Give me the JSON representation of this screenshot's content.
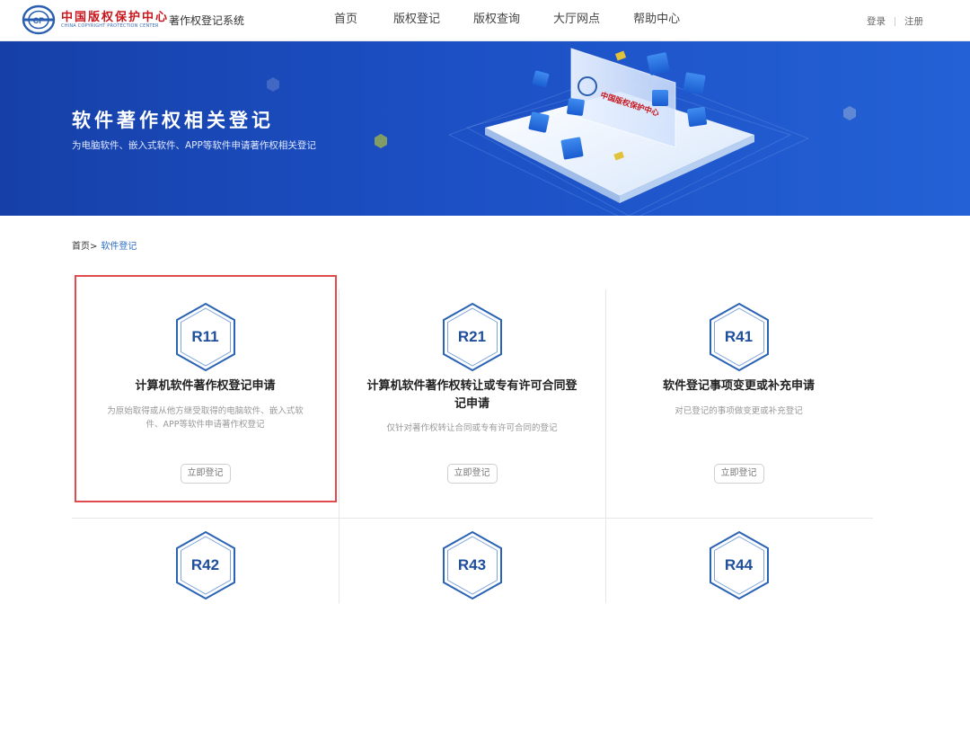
{
  "header": {
    "brand_cn": "中国版权保护中心",
    "brand_en": "CHINA COPYRIGHT PROTECTION CENTER",
    "system_title": "著作权登记系统",
    "nav": [
      "首页",
      "版权登记",
      "版权查询",
      "大厅网点",
      "帮助中心"
    ],
    "login": "登录",
    "register": "注册"
  },
  "banner": {
    "title": "软件著作权相关登记",
    "subtitle": "为电脑软件、嵌入式软件、APP等软件申请著作权相关登记",
    "board_text": "中国版权保护中心"
  },
  "breadcrumb": {
    "home": "首页>",
    "current": "软件登记"
  },
  "cards": [
    {
      "code": "R11",
      "title": "计算机软件著作权登记申请",
      "desc": "为原始取得或从他方继受取得的电脑软件、嵌入式软件、APP等软件申请著作权登记",
      "button": "立即登记",
      "highlighted": true
    },
    {
      "code": "R21",
      "title": "计算机软件著作权转让或专有许可合同登记申请",
      "desc": "仅针对著作权转让合同或专有许可合同的登记",
      "button": "立即登记",
      "highlighted": false
    },
    {
      "code": "R41",
      "title": "软件登记事项变更或补充申请",
      "desc": "对已登记的事项做变更或补充登记",
      "button": "立即登记",
      "highlighted": false
    },
    {
      "code": "R42"
    },
    {
      "code": "R43"
    },
    {
      "code": "R44"
    }
  ],
  "colors": {
    "accent": "#1f4f9c",
    "banner": "#1c4fc4",
    "highlight": "#e14b4b",
    "brand_red": "#c8161d"
  }
}
